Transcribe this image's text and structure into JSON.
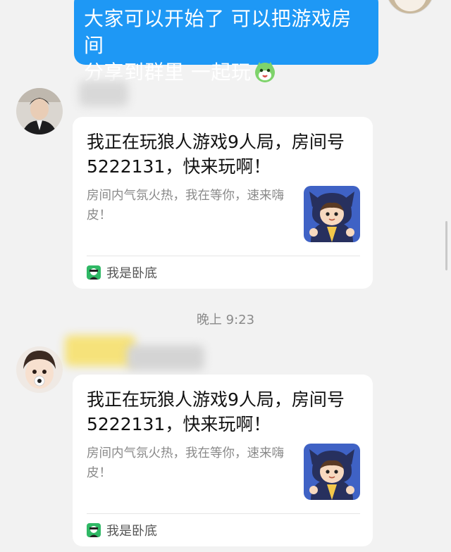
{
  "outgoing": {
    "line1": "大家可以开始了 可以把游戏房间",
    "line2": "分享到群里 一起玩",
    "emoji": "green-cat-emoji",
    "bubble_color": "#1e98f5"
  },
  "messages": [
    {
      "card": {
        "title": "我正在玩狼人游戏9人局，房间号5222131，快来玩啊！",
        "description": "房间内气氛火热，我在等你，速来嗨皮！",
        "source_app": "我是卧底",
        "thumbnail_icon": "werewolf-boy-icon"
      }
    },
    {
      "card": {
        "title": "我正在玩狼人游戏9人局，房间号5222131，快来玩啊！",
        "description": "房间内气氛火热，我在等你，速来嗨皮！",
        "source_app": "我是卧底",
        "thumbnail_icon": "werewolf-boy-icon"
      }
    }
  ],
  "timestamp": "晚上 9:23",
  "colors": {
    "background": "#f2f2f2",
    "card": "#ffffff",
    "description_text": "#8a8a8a"
  }
}
